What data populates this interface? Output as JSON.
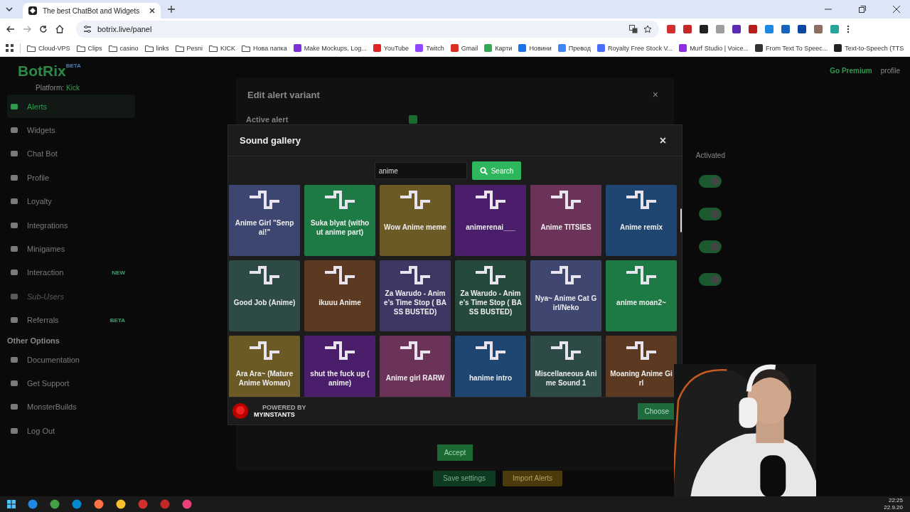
{
  "browser": {
    "tab": {
      "title": "The best ChatBot and Widgets"
    },
    "address": "botrix.live/panel",
    "bookmarks": [
      {
        "kind": "folder",
        "label": "Cloud-VPS"
      },
      {
        "kind": "folder",
        "label": "Clips"
      },
      {
        "kind": "folder",
        "label": "casino"
      },
      {
        "kind": "folder",
        "label": "links"
      },
      {
        "kind": "folder",
        "label": "Pesni"
      },
      {
        "kind": "folder",
        "label": "KICK"
      },
      {
        "kind": "folder",
        "label": "Нова папка"
      },
      {
        "kind": "site",
        "label": "Make Mockups, Log...",
        "color": "#7b2fd6"
      },
      {
        "kind": "site",
        "label": "YouTube",
        "color": "#e02424"
      },
      {
        "kind": "site",
        "label": "Twitch",
        "color": "#9146ff"
      },
      {
        "kind": "site",
        "label": "Gmail",
        "color": "#d93025"
      },
      {
        "kind": "site",
        "label": "Карти",
        "color": "#34a853"
      },
      {
        "kind": "site",
        "label": "Новини",
        "color": "#1a73e8"
      },
      {
        "kind": "site",
        "label": "Превод",
        "color": "#4285f4"
      },
      {
        "kind": "site",
        "label": "Royalty Free Stock V...",
        "color": "#4a6cf7"
      },
      {
        "kind": "site",
        "label": "Murf Studio | Voice...",
        "color": "#8e2de2"
      },
      {
        "kind": "site",
        "label": "From Text To Speec...",
        "color": "#333333"
      },
      {
        "kind": "site",
        "label": "Text-to-Speech (TTS",
        "color": "#222222"
      }
    ]
  },
  "sidebar": {
    "logo": "BotRix",
    "logo_badge": "BETA",
    "platform_label": "Platform:",
    "platform": "Kick",
    "items": [
      {
        "label": "Alerts",
        "selected": true,
        "disabled": false
      },
      {
        "label": "Widgets",
        "selected": false,
        "disabled": false
      },
      {
        "label": "Chat Bot",
        "selected": false,
        "disabled": false
      },
      {
        "label": "Profile",
        "selected": false,
        "disabled": false
      },
      {
        "label": "Loyalty",
        "selected": false,
        "disabled": false
      },
      {
        "label": "Integrations",
        "selected": false,
        "disabled": false
      },
      {
        "label": "Minigames",
        "selected": false,
        "disabled": false
      },
      {
        "label": "Interaction",
        "selected": false,
        "disabled": false,
        "badge": "NEW"
      },
      {
        "label": "Sub-Users",
        "selected": false,
        "disabled": true
      },
      {
        "label": "Referrals",
        "selected": false,
        "disabled": false,
        "badge": "BETA"
      }
    ],
    "section_title": "Other Options",
    "other_items": [
      {
        "label": "Documentation"
      },
      {
        "label": "Get Support"
      },
      {
        "label": "MonsterBuilds"
      },
      {
        "label": "Log Out"
      }
    ]
  },
  "header": {
    "premium": "Go Premium",
    "profile": "profile"
  },
  "activated": {
    "title": "Activated",
    "toggles": [
      {
        "on": true
      },
      {
        "on": true
      },
      {
        "on": true
      },
      {
        "on": true
      }
    ]
  },
  "page_buttons": [
    "Save settings",
    "Import Alerts"
  ],
  "edit_modal": {
    "title": "Edit alert variant",
    "close": "×",
    "active_label": "Active alert",
    "active_checked": true,
    "accept": "Accept"
  },
  "sound_gallery": {
    "title": "Sound gallery",
    "close": "×",
    "search": {
      "value": "anime",
      "button": "Search"
    },
    "sounds": [
      {
        "title": "Anime Girl \"Senpai!\"",
        "color": "#3d4670"
      },
      {
        "title": "Suka blyat (without anime part)",
        "color": "#1e7a45"
      },
      {
        "title": "Wow Anime meme",
        "color": "#6b5a25"
      },
      {
        "title": "animerenai___",
        "color": "#4a1e6b"
      },
      {
        "title": "Anime TITSIES",
        "color": "#6b3358"
      },
      {
        "title": "Anime remix",
        "color": "#1f4670"
      },
      {
        "title": "Good Job (Anime)",
        "color": "#2e4a47"
      },
      {
        "title": "ikuuu Anime",
        "color": "#5c3a22"
      },
      {
        "title": "Za Warudo - Anime's Time Stop ( BASS BUSTED)",
        "color": "#3f3663"
      },
      {
        "title": "Za Warudo - Anime's Time Stop ( BASS BUSTED)",
        "color": "#25493a"
      },
      {
        "title": "Nya~ Anime Cat Girl/Neko",
        "color": "#3f4670"
      },
      {
        "title": "anime moan2~",
        "color": "#1e7a45"
      },
      {
        "title": "Ara Ara~ (Mature Anime Woman)",
        "color": "#6b5a25"
      },
      {
        "title": "shut the fuck up ( anime)",
        "color": "#4a1e6b"
      },
      {
        "title": "Anime girl RARW",
        "color": "#6b3358"
      },
      {
        "title": "hanime intro",
        "color": "#1f4670"
      },
      {
        "title": "Miscellaneous Anime Sound 1",
        "color": "#2e4a47"
      },
      {
        "title": "Moaning Anime Girl",
        "color": "#5c3a22"
      }
    ],
    "powered_by": "POWERED BY",
    "provider": "MYINSTANTS",
    "choose": "Choose"
  },
  "taskbar": {
    "time": "22:25",
    "date": "22.9.20"
  }
}
